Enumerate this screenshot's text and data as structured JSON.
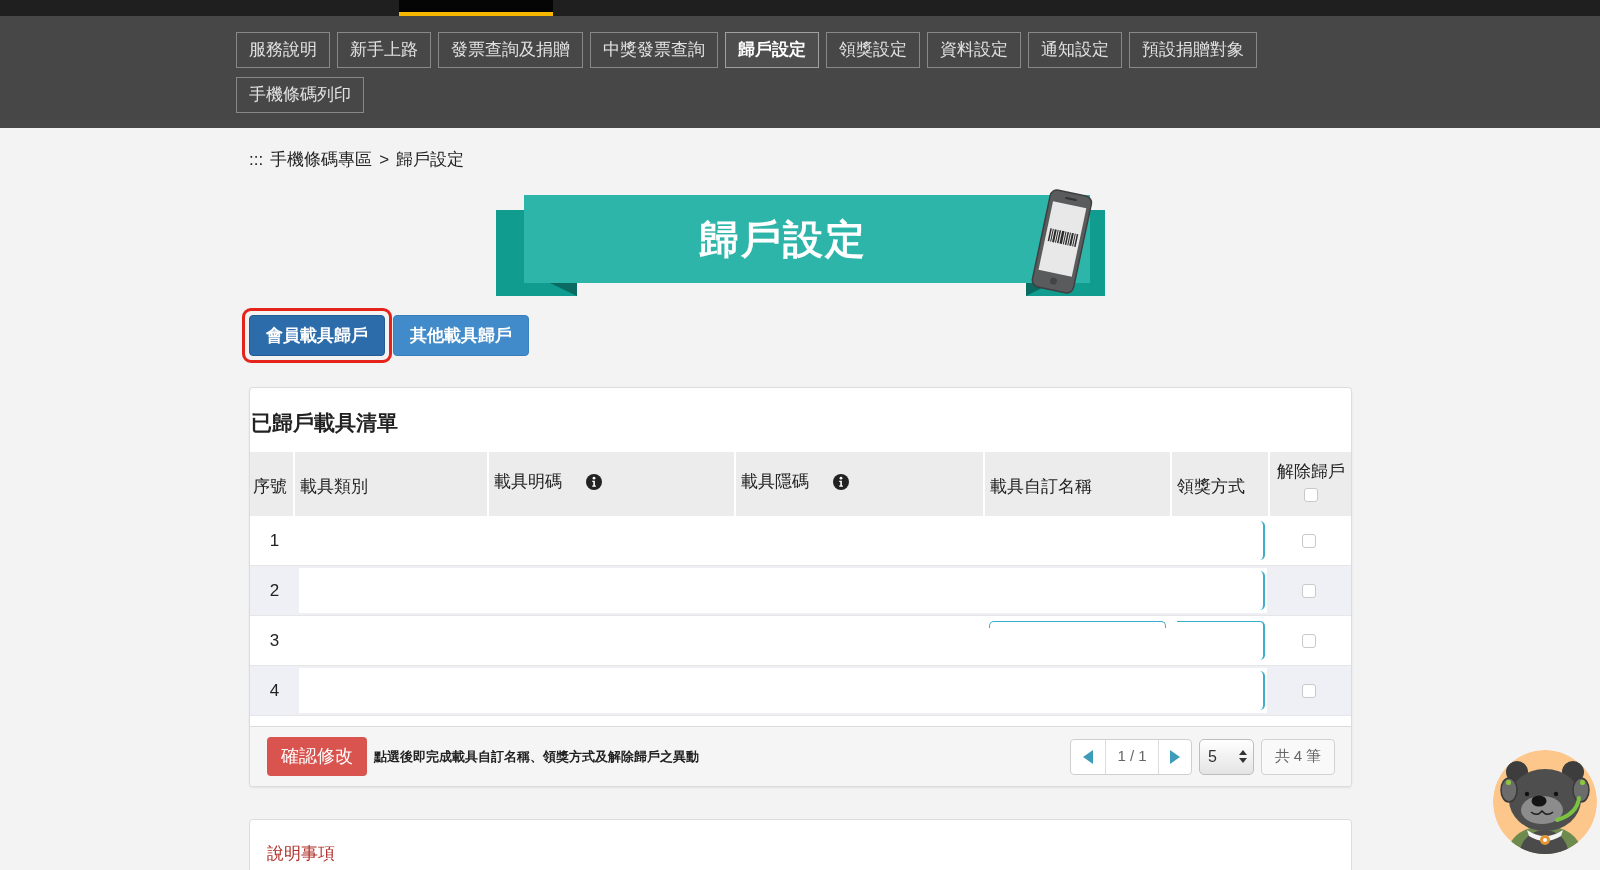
{
  "nav": {
    "items": [
      {
        "label": "服務說明",
        "selected": false
      },
      {
        "label": "新手上路",
        "selected": false
      },
      {
        "label": "發票查詢及捐贈",
        "selected": false
      },
      {
        "label": "中獎發票查詢",
        "selected": false
      },
      {
        "label": "歸戶設定",
        "selected": true
      },
      {
        "label": "領獎設定",
        "selected": false
      },
      {
        "label": "資料設定",
        "selected": false
      },
      {
        "label": "通知設定",
        "selected": false
      },
      {
        "label": "預設捐贈對象",
        "selected": false
      },
      {
        "label": "手機條碼列印",
        "selected": false
      }
    ]
  },
  "breadcrumb": {
    "anchor": ":::",
    "items": [
      "手機條碼專區",
      "歸戶設定"
    ],
    "separator": ">"
  },
  "banner": {
    "title": "歸戶設定"
  },
  "carrier_tabs": [
    {
      "label": "會員載具歸戶",
      "selected": true,
      "highlighted": true
    },
    {
      "label": "其他載具歸戶",
      "selected": false,
      "highlighted": false
    }
  ],
  "carrier_list": {
    "title": "已歸戶載具清單",
    "columns": [
      {
        "label": "序號",
        "kind": "plain"
      },
      {
        "label": "載具類別",
        "kind": "plain"
      },
      {
        "label": "載具明碼",
        "kind": "info"
      },
      {
        "label": "載具隱碼",
        "kind": "info"
      },
      {
        "label": "載具自訂名稱",
        "kind": "plain"
      },
      {
        "label": "領獎方式",
        "kind": "plain"
      },
      {
        "label": "解除歸戶",
        "kind": "select_all"
      }
    ],
    "select_all_checked": false,
    "rows": [
      {
        "number": "1",
        "checked": false,
        "fields_visible": false
      },
      {
        "number": "2",
        "checked": false,
        "fields_visible": false
      },
      {
        "number": "3",
        "checked": false,
        "fields_visible": true
      },
      {
        "number": "4",
        "checked": false,
        "fields_visible": false
      }
    ],
    "confirm_button": "確認修改",
    "confirm_note": "點選後即完成載具自訂名稱、領獎方式及解除歸戶之異動",
    "pager": {
      "page": "1 / 1",
      "page_size": "5",
      "total": "共 4 筆"
    }
  },
  "notes": {
    "title": "說明事項"
  }
}
